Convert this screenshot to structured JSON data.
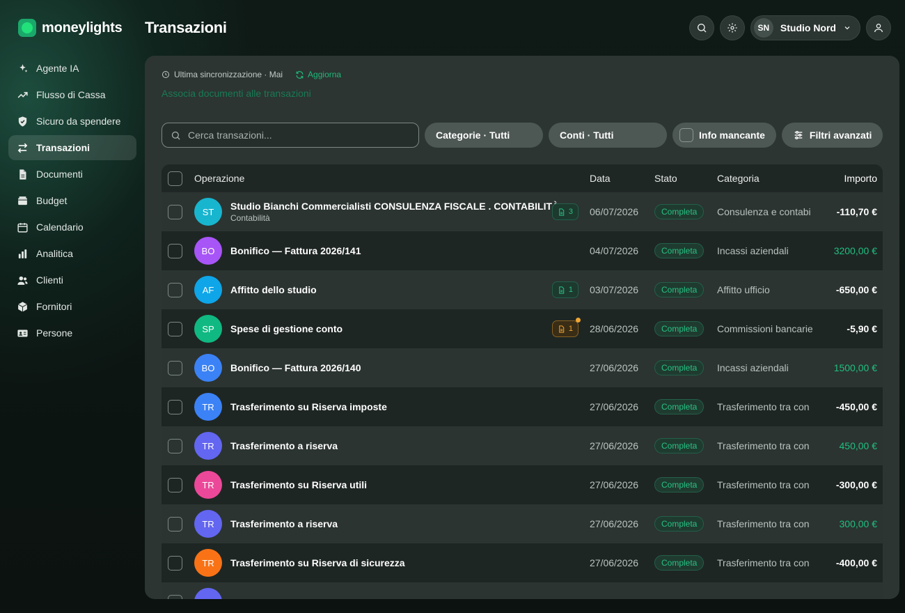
{
  "brand": {
    "name": "moneylights"
  },
  "page": {
    "title": "Transazioni"
  },
  "org": {
    "initials": "SN",
    "name": "Studio Nord"
  },
  "sidebar": {
    "items": [
      {
        "label": "Agente IA",
        "icon": "sparkles-icon"
      },
      {
        "label": "Flusso di Cassa",
        "icon": "trend-up-icon"
      },
      {
        "label": "Sicuro da spendere",
        "icon": "shield-check-icon"
      },
      {
        "label": "Transazioni",
        "icon": "arrows-swap-icon",
        "active": true
      },
      {
        "label": "Documenti",
        "icon": "document-icon"
      },
      {
        "label": "Budget",
        "icon": "wallet-icon"
      },
      {
        "label": "Calendario",
        "icon": "calendar-icon"
      },
      {
        "label": "Analitica",
        "icon": "bar-chart-icon"
      },
      {
        "label": "Clienti",
        "icon": "users-icon"
      },
      {
        "label": "Fornitori",
        "icon": "box-icon"
      },
      {
        "label": "Persone",
        "icon": "id-card-icon"
      }
    ]
  },
  "panel": {
    "sync_label": "Ultima sincronizzazione · Mai",
    "refresh_label": "Aggiorna",
    "link_docs": "Associa documenti alle transazioni"
  },
  "filters": {
    "search_placeholder": "Cerca transazioni...",
    "categories": "Categorie · Tutti",
    "accounts": "Conti · Tutti",
    "missing_info": "Info mancante",
    "advanced": "Filtri avanzati"
  },
  "table": {
    "headers": {
      "operation": "Operazione",
      "date": "Data",
      "status": "Stato",
      "category": "Categoria",
      "amount": "Importo"
    },
    "rows": [
      {
        "initials": "ST",
        "color": "#18b5cf",
        "title": "Studio Bianchi Commercialisti CONSULENZA FISCALE . CONTABILITÀ",
        "subtitle": "Contabilità",
        "docs": "3",
        "doc_state": "ok",
        "date": "06/07/2026",
        "status": "Completa",
        "category": "Consulenza e contabi",
        "amount": "-110,70 €",
        "positive": false
      },
      {
        "initials": "BO",
        "color": "#a855f7",
        "title": "Bonifico — Fattura 2026/141",
        "subtitle": "",
        "docs": "",
        "doc_state": "",
        "date": "04/07/2026",
        "status": "Completa",
        "category": "Incassi aziendali",
        "amount": "3200,00 €",
        "positive": true
      },
      {
        "initials": "AF",
        "color": "#0ea5e9",
        "title": "Affitto dello studio",
        "subtitle": "",
        "docs": "1",
        "doc_state": "ok",
        "date": "03/07/2026",
        "status": "Completa",
        "category": "Affitto ufficio",
        "amount": "-650,00 €",
        "positive": false
      },
      {
        "initials": "SP",
        "color": "#10b981",
        "title": "Spese di gestione conto",
        "subtitle": "",
        "docs": "1",
        "doc_state": "warn",
        "date": "28/06/2026",
        "status": "Completa",
        "category": "Commissioni bancarie",
        "amount": "-5,90 €",
        "positive": false
      },
      {
        "initials": "BO",
        "color": "#3b82f6",
        "title": "Bonifico — Fattura 2026/140",
        "subtitle": "",
        "docs": "",
        "doc_state": "",
        "date": "27/06/2026",
        "status": "Completa",
        "category": "Incassi aziendali",
        "amount": "1500,00 €",
        "positive": true
      },
      {
        "initials": "TR",
        "color": "#3b82f6",
        "title": "Trasferimento su Riserva imposte",
        "subtitle": "",
        "docs": "",
        "doc_state": "",
        "date": "27/06/2026",
        "status": "Completa",
        "category": "Trasferimento tra con",
        "amount": "-450,00 €",
        "positive": false
      },
      {
        "initials": "TR",
        "color": "#6366f1",
        "title": "Trasferimento a riserva",
        "subtitle": "",
        "docs": "",
        "doc_state": "",
        "date": "27/06/2026",
        "status": "Completa",
        "category": "Trasferimento tra con",
        "amount": "450,00 €",
        "positive": true
      },
      {
        "initials": "TR",
        "color": "#ec4899",
        "title": "Trasferimento su Riserva utili",
        "subtitle": "",
        "docs": "",
        "doc_state": "",
        "date": "27/06/2026",
        "status": "Completa",
        "category": "Trasferimento tra con",
        "amount": "-300,00 €",
        "positive": false
      },
      {
        "initials": "TR",
        "color": "#6366f1",
        "title": "Trasferimento a riserva",
        "subtitle": "",
        "docs": "",
        "doc_state": "",
        "date": "27/06/2026",
        "status": "Completa",
        "category": "Trasferimento tra con",
        "amount": "300,00 €",
        "positive": true
      },
      {
        "initials": "TR",
        "color": "#f97316",
        "title": "Trasferimento su Riserva di sicurezza",
        "subtitle": "",
        "docs": "",
        "doc_state": "",
        "date": "27/06/2026",
        "status": "Completa",
        "category": "Trasferimento tra con",
        "amount": "-400,00 €",
        "positive": false
      },
      {
        "initials": "",
        "color": "#6366f1",
        "title": "",
        "subtitle": "",
        "docs": "",
        "doc_state": "",
        "date": "",
        "status": "",
        "category": "",
        "amount": "",
        "positive": false
      }
    ]
  },
  "colors": {
    "accent": "#1fb87a",
    "background": "#0f1a16",
    "panel": "#2c3532",
    "positive": "#1fbf7f",
    "warning": "#f0a631"
  }
}
